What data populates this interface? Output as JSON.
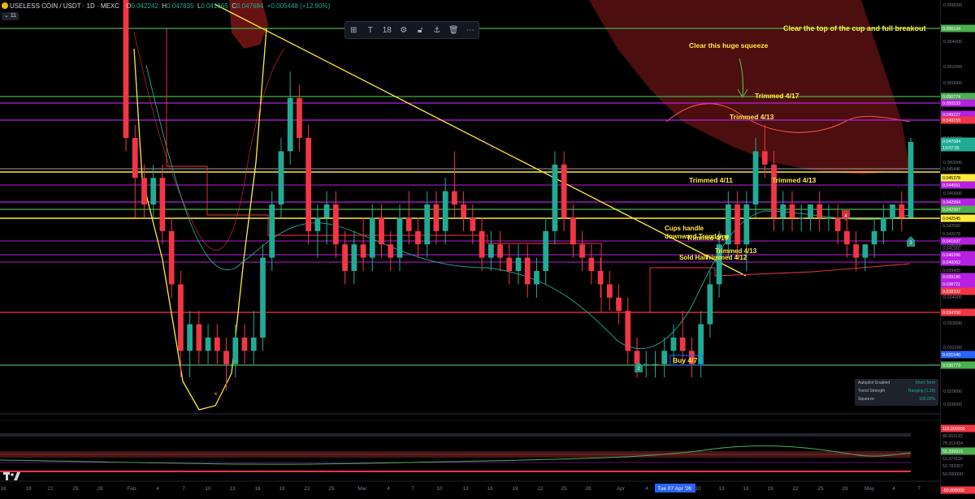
{
  "header": {
    "symbol": "USELESS COIN / USDT · 1D · MEXC",
    "open_label": "O",
    "open": "0.042242",
    "high_label": "H",
    "high": "0.047835",
    "low_label": "L",
    "low": "0.041665",
    "close_label": "C",
    "close": "0.047684",
    "change": "+0.005448 (+12.90%)",
    "indicator_count": "11"
  },
  "toolbar": {
    "items": [
      "layout-icon",
      "text-icon",
      "18",
      "settings-icon",
      "lock-icon",
      "anchor-icon",
      "trash-icon",
      "more-icon"
    ],
    "font_size": "18"
  },
  "colors": {
    "up": "#22ab94",
    "down": "#f23645",
    "green_line": "#4caf50",
    "red_line": "#f23645",
    "yellow": "#ffeb3b",
    "purple": "#b620e0",
    "band": "#8b1a1a",
    "annotation": "#ffeb3b"
  },
  "price_axis": {
    "ticks": [
      "0.058000",
      "0.054000",
      "0.052000",
      "0.050000",
      "0.048000",
      "0.046000",
      "0.044000",
      "0.042000",
      "0.040000",
      "0.038000",
      "0.036000",
      "0.034000",
      "0.033000",
      "0.032000",
      "0.030000",
      "0.029000",
      "0.028000"
    ],
    "badges": [
      {
        "label": "0.056134",
        "color": "#4caf50"
      },
      {
        "label": "0.050774",
        "color": "#4caf50"
      },
      {
        "label": "0.050533",
        "color": "#b620e0"
      },
      {
        "label": "0.049227",
        "color": "#b620e0"
      },
      {
        "label": "0.049159",
        "color": "#f23645"
      },
      {
        "label": "0.047684",
        "color": "#22ab94"
      },
      {
        "label": "13:07:35",
        "color": "#22ab94"
      },
      {
        "label": "0.045446",
        "color": "#000000"
      },
      {
        "label": "0.045378",
        "color": "#ffeb3b"
      },
      {
        "label": "0.044551",
        "color": "#b620e0"
      },
      {
        "label": "0.042994",
        "color": "#b620e0"
      },
      {
        "label": "0.042987",
        "color": "#4caf50"
      },
      {
        "label": "0.042545",
        "color": "#ffeb3b"
      },
      {
        "label": "0.042500",
        "color": "#000000"
      },
      {
        "label": "0.042078",
        "color": "#000000"
      },
      {
        "label": "0.041597",
        "color": "#b620e0"
      },
      {
        "label": "0.041160",
        "color": "#000000"
      },
      {
        "label": "0.040266",
        "color": "#b620e0"
      },
      {
        "label": "0.040062",
        "color": "#b620e0"
      },
      {
        "label": "0.039405",
        "color": "#000000"
      },
      {
        "label": "0.039186",
        "color": "#b620e0"
      },
      {
        "label": "0.038721",
        "color": "#b620e0"
      },
      {
        "label": "0.038332",
        "color": "#f23645"
      },
      {
        "label": "0.034700",
        "color": "#f23645"
      },
      {
        "label": "0.031540",
        "color": "#2962ff"
      },
      {
        "label": "0.030773",
        "color": "#4caf50"
      }
    ],
    "osc_badges": [
      {
        "label": "110.000000",
        "color": "#f23645"
      },
      {
        "label": "86.553192",
        "color": "#000000"
      },
      {
        "label": "78.312434",
        "color": "#000000"
      },
      {
        "label": "55.399915",
        "color": "#4caf50"
      },
      {
        "label": "53.474126",
        "color": "#000000"
      },
      {
        "label": "52.783357",
        "color": "#000000"
      },
      {
        "label": "50.000000",
        "color": "#000000"
      },
      {
        "label": "-50.000000",
        "color": "#f23645"
      }
    ]
  },
  "time_axis": {
    "labels": [
      "16",
      "19",
      "22",
      "25",
      "28",
      "Feb",
      "4",
      "7",
      "10",
      "13",
      "16",
      "19",
      "22",
      "25",
      "Mar",
      "4",
      "7",
      "10",
      "13",
      "16",
      "19",
      "22",
      "25",
      "28",
      "Apr",
      "4",
      "Tue 07 Apr '26",
      "10",
      "13",
      "16",
      "19",
      "22",
      "25",
      "28",
      "May",
      "4",
      "7"
    ],
    "current_date": "Tue 07 Apr '26"
  },
  "annotations": [
    {
      "text": "Clear the top of the cup and full breakout"
    },
    {
      "text": "Clear this huge squeeze"
    },
    {
      "text": "Trimmed 4/17"
    },
    {
      "text": "Trimmed 4/13"
    },
    {
      "text": "Trimmed 4/11"
    },
    {
      "text": "Trimmed 4/13"
    },
    {
      "text": "Cups handle"
    },
    {
      "text": "downward Trend line"
    },
    {
      "text": "Trimmed 4/10"
    },
    {
      "text": "Sold Half"
    },
    {
      "text": "Trimmed 4/13"
    },
    {
      "text": "Trimmed 4/12"
    },
    {
      "text": "Buy 4/7"
    }
  ],
  "markers": [
    {
      "text": "2",
      "color": "#22ab94"
    },
    {
      "text": "3",
      "color": "#22ab94"
    },
    {
      "text": "4",
      "color": "#f23645"
    }
  ],
  "info_panel": {
    "rows": [
      {
        "label": "Autopilot Enabled",
        "value": "Short-Term"
      },
      {
        "label": "Trend Strength",
        "value": "Ranging (1.39)"
      },
      {
        "label": "Squeeze",
        "value": "100.00%"
      }
    ]
  },
  "chart_data": {
    "type": "candlestick",
    "price_unit": "USDT",
    "ylim": [
      0.028,
      0.058
    ],
    "candles": [
      [
        0.06,
        0.061,
        0.047,
        0.048
      ],
      [
        0.048,
        0.049,
        0.042,
        0.045
      ],
      [
        0.045,
        0.046,
        0.042,
        0.043
      ],
      [
        0.043,
        0.046,
        0.042,
        0.045
      ],
      [
        0.045,
        0.046,
        0.04,
        0.041
      ],
      [
        0.041,
        0.042,
        0.036,
        0.037
      ],
      [
        0.037,
        0.038,
        0.03,
        0.032
      ],
      [
        0.032,
        0.035,
        0.03,
        0.034
      ],
      [
        0.034,
        0.035,
        0.031,
        0.032
      ],
      [
        0.032,
        0.034,
        0.031,
        0.033
      ],
      [
        0.033,
        0.034,
        0.031,
        0.032
      ],
      [
        0.032,
        0.033,
        0.029,
        0.031
      ],
      [
        0.031,
        0.034,
        0.03,
        0.033
      ],
      [
        0.033,
        0.034,
        0.031,
        0.032
      ],
      [
        0.032,
        0.035,
        0.031,
        0.033
      ],
      [
        0.033,
        0.04,
        0.032,
        0.039
      ],
      [
        0.039,
        0.044,
        0.038,
        0.043
      ],
      [
        0.043,
        0.048,
        0.042,
        0.047
      ],
      [
        0.047,
        0.053,
        0.046,
        0.051
      ],
      [
        0.051,
        0.052,
        0.047,
        0.048
      ],
      [
        0.048,
        0.049,
        0.04,
        0.041
      ],
      [
        0.041,
        0.043,
        0.039,
        0.042
      ],
      [
        0.042,
        0.044,
        0.04,
        0.043
      ],
      [
        0.043,
        0.044,
        0.039,
        0.04
      ],
      [
        0.04,
        0.041,
        0.037,
        0.038
      ],
      [
        0.038,
        0.041,
        0.037,
        0.04
      ],
      [
        0.04,
        0.042,
        0.038,
        0.039
      ],
      [
        0.039,
        0.043,
        0.038,
        0.042
      ],
      [
        0.042,
        0.043,
        0.039,
        0.04
      ],
      [
        0.04,
        0.041,
        0.038,
        0.039
      ],
      [
        0.039,
        0.043,
        0.038,
        0.042
      ],
      [
        0.042,
        0.044,
        0.04,
        0.041
      ],
      [
        0.041,
        0.042,
        0.039,
        0.04
      ],
      [
        0.04,
        0.044,
        0.039,
        0.043
      ],
      [
        0.043,
        0.044,
        0.04,
        0.041
      ],
      [
        0.041,
        0.045,
        0.04,
        0.044
      ],
      [
        0.044,
        0.047,
        0.042,
        0.043
      ],
      [
        0.043,
        0.044,
        0.041,
        0.042
      ],
      [
        0.042,
        0.043,
        0.04,
        0.041
      ],
      [
        0.041,
        0.042,
        0.038,
        0.039
      ],
      [
        0.039,
        0.041,
        0.038,
        0.04
      ],
      [
        0.04,
        0.041,
        0.038,
        0.039
      ],
      [
        0.039,
        0.04,
        0.037,
        0.038
      ],
      [
        0.038,
        0.04,
        0.037,
        0.039
      ],
      [
        0.039,
        0.04,
        0.036,
        0.037
      ],
      [
        0.037,
        0.039,
        0.036,
        0.038
      ],
      [
        0.038,
        0.042,
        0.037,
        0.041
      ],
      [
        0.041,
        0.047,
        0.04,
        0.046
      ],
      [
        0.046,
        0.047,
        0.041,
        0.042
      ],
      [
        0.042,
        0.043,
        0.039,
        0.04
      ],
      [
        0.04,
        0.041,
        0.038,
        0.039
      ],
      [
        0.039,
        0.04,
        0.037,
        0.038
      ],
      [
        0.038,
        0.039,
        0.036,
        0.037
      ],
      [
        0.037,
        0.038,
        0.035,
        0.036
      ],
      [
        0.036,
        0.037,
        0.034,
        0.035
      ],
      [
        0.035,
        0.036,
        0.031,
        0.032
      ],
      [
        0.032,
        0.033,
        0.03,
        0.031
      ],
      [
        0.031,
        0.032,
        0.03,
        0.031
      ],
      [
        0.031,
        0.032,
        0.03,
        0.031
      ],
      [
        0.031,
        0.033,
        0.03,
        0.032
      ],
      [
        0.032,
        0.034,
        0.031,
        0.033
      ],
      [
        0.033,
        0.035,
        0.031,
        0.032
      ],
      [
        0.032,
        0.033,
        0.03,
        0.031
      ],
      [
        0.031,
        0.035,
        0.03,
        0.034
      ],
      [
        0.034,
        0.038,
        0.033,
        0.037
      ],
      [
        0.037,
        0.041,
        0.036,
        0.04
      ],
      [
        0.04,
        0.044,
        0.039,
        0.043
      ],
      [
        0.043,
        0.044,
        0.039,
        0.04
      ],
      [
        0.04,
        0.044,
        0.038,
        0.043
      ],
      [
        0.043,
        0.048,
        0.042,
        0.047
      ],
      [
        0.047,
        0.049,
        0.045,
        0.046
      ],
      [
        0.046,
        0.047,
        0.041,
        0.042
      ],
      [
        0.042,
        0.044,
        0.041,
        0.043
      ],
      [
        0.043,
        0.044,
        0.041,
        0.042
      ],
      [
        0.042,
        0.043,
        0.041,
        0.042
      ],
      [
        0.042,
        0.043,
        0.041,
        0.043
      ],
      [
        0.043,
        0.044,
        0.041,
        0.042
      ],
      [
        0.042,
        0.043,
        0.041,
        0.042
      ],
      [
        0.042,
        0.043,
        0.04,
        0.041
      ],
      [
        0.041,
        0.042,
        0.039,
        0.04
      ],
      [
        0.04,
        0.041,
        0.038,
        0.039
      ],
      [
        0.039,
        0.04,
        0.038,
        0.04
      ],
      [
        0.04,
        0.042,
        0.039,
        0.041
      ],
      [
        0.041,
        0.043,
        0.04,
        0.042
      ],
      [
        0.042,
        0.043,
        0.041,
        0.043
      ],
      [
        0.043,
        0.044,
        0.041,
        0.042
      ],
      [
        0.042,
        0.048,
        0.042,
        0.0477
      ]
    ]
  }
}
